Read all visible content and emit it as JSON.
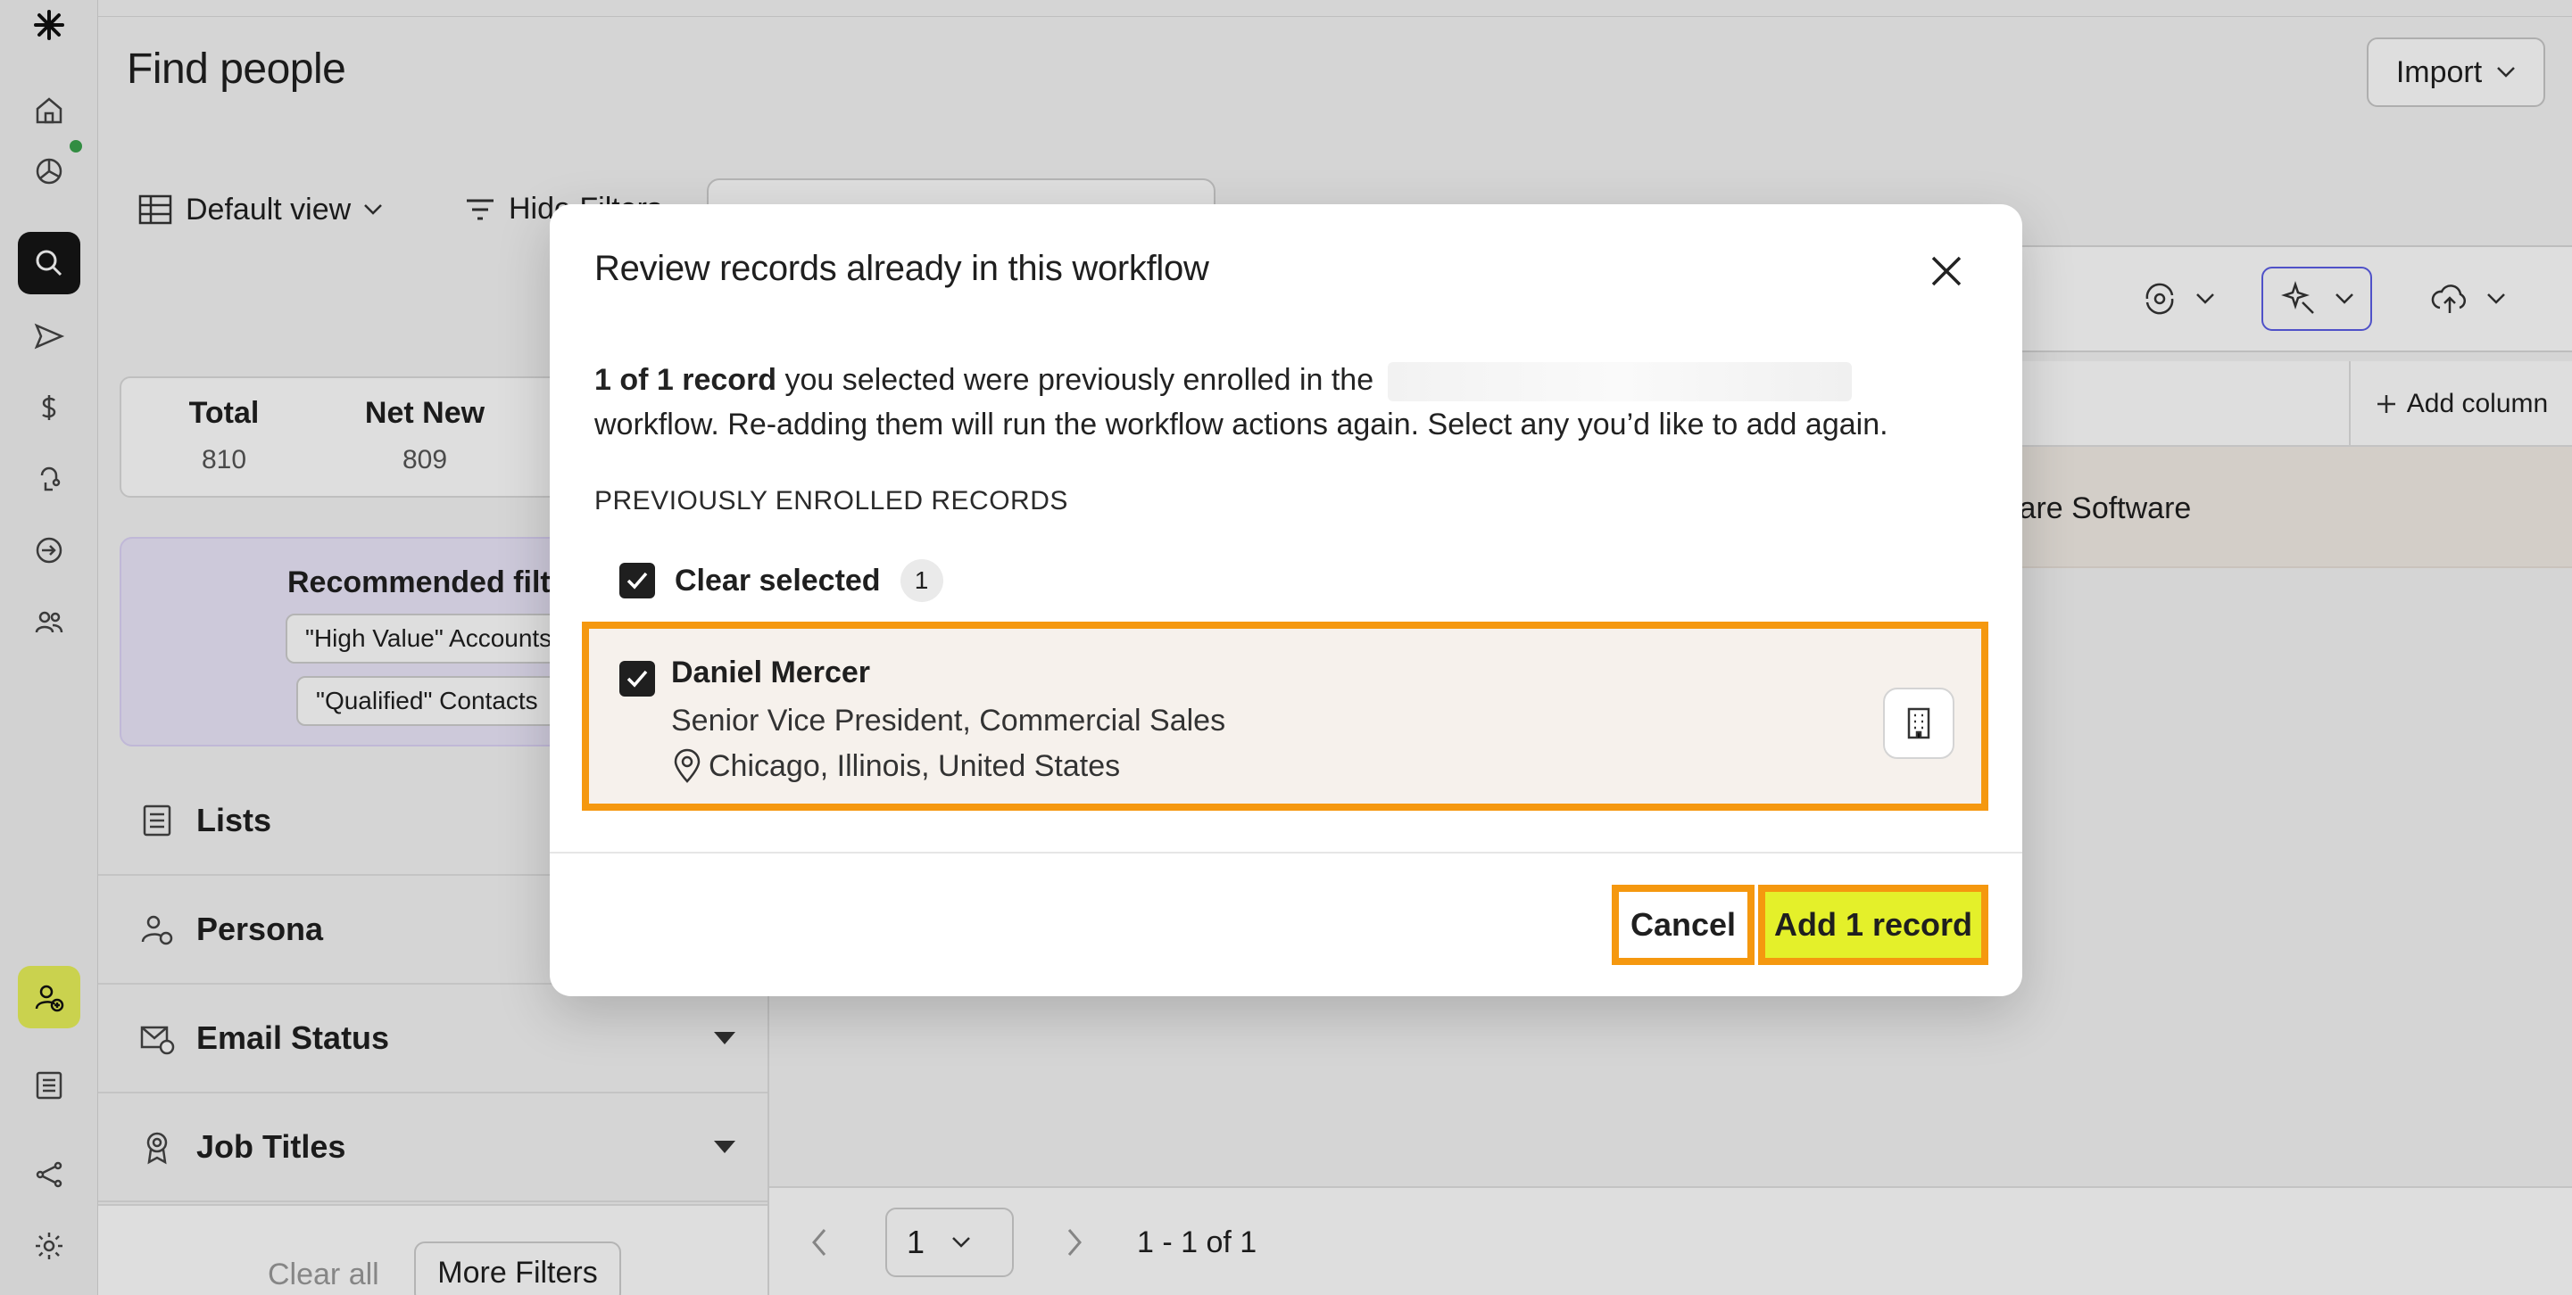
{
  "page": {
    "title": "Find people",
    "import_label": "Import"
  },
  "toolbar": {
    "default_view": "Default view",
    "hide_filters": "Hide Filters"
  },
  "stats": {
    "total_label": "Total",
    "total_value": "810",
    "netnew_label": "Net New",
    "netnew_value": "809"
  },
  "recommended": {
    "title": "Recommended filters",
    "chip1": "\"High Value\" Accounts",
    "chip2": "\"Qualified\" Contacts"
  },
  "filters": [
    {
      "label": "Lists"
    },
    {
      "label": "Persona"
    },
    {
      "label": "Email Status"
    },
    {
      "label": "Job Titles"
    }
  ],
  "panel_footer": {
    "clear_all": "Clear all",
    "more_filters": "More Filters"
  },
  "table": {
    "add_column": "Add column",
    "row_company": "ware Software"
  },
  "pager": {
    "page": "1",
    "range": "1 - 1 of 1"
  },
  "modal": {
    "title": "Review records already in this workflow",
    "desc_bold": "1 of 1 record",
    "desc_part1": " you selected were previously enrolled in the",
    "desc_part2": " workflow. Re-adding them will run the workflow actions again. Select any you’d like to add again.",
    "section_label": "PREVIOUSLY ENROLLED RECORDS",
    "clear_selected": "Clear selected",
    "selected_count": "1",
    "record": {
      "name": "Daniel Mercer",
      "title": "Senior Vice President, Commercial Sales",
      "location": "Chicago, Illinois, United States"
    },
    "cancel": "Cancel",
    "add": "Add 1 record"
  },
  "colors": {
    "accent_yellow": "#e4f02a",
    "highlight_orange": "#f5980f",
    "purple_outline": "#5b5ee6",
    "online_green": "#3aa24c"
  }
}
